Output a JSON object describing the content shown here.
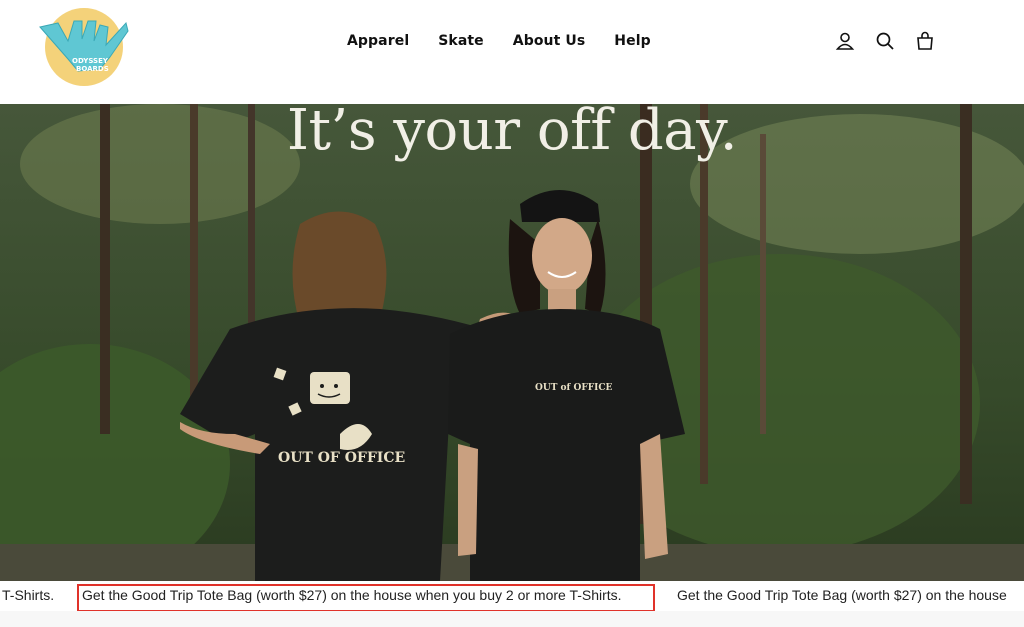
{
  "brand": {
    "logo_text": [
      "ODYSSEY",
      "BOARDS"
    ]
  },
  "nav": {
    "items": [
      {
        "label": "Apparel"
      },
      {
        "label": "Skate"
      },
      {
        "label": "About Us"
      },
      {
        "label": "Help"
      }
    ]
  },
  "header_icons": [
    "user-icon",
    "search-icon",
    "cart-icon"
  ],
  "hero": {
    "headline": "It’s your off day.",
    "shirt_back_text": "OUT OF OFFICE",
    "shirt_front_text": "OUT of OFFICE"
  },
  "announcement": {
    "fragment": "T-Shirts.",
    "message": "Get the Good Trip Tote Bag (worth $27) on the house when you buy 2 or more T-Shirts.",
    "message_repeat": "Get the Good Trip Tote Bag (worth $27) on the house"
  },
  "colors": {
    "logo_yellow": "#f4d27a",
    "logo_cyan": "#5fc7d3",
    "highlight_red": "#e0322a",
    "headline_cream": "#f1efe6"
  }
}
